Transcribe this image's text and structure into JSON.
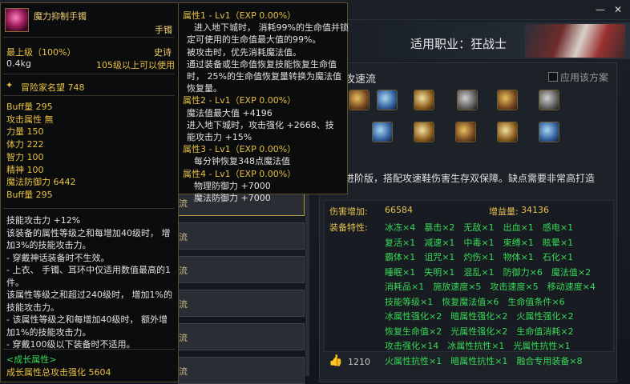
{
  "right_panel": {
    "job_label": "适用职业：狂战士",
    "plan_title": "攻速流",
    "apply_label": "应用该方案",
    "description": "进阶版，搭配攻速鞋伤害生存双保障。缺点需要非常高打造",
    "damage_label": "伤害增加:",
    "damage_value": "66584",
    "gain_label": "增益量:",
    "gain_value": "34136",
    "traits_label": "装备特性:",
    "traits": [
      "冰冻×4　暴击×2　无敌×1　出血×1　感电×1",
      "复活×1　减速×1　中毒×1　束缚×1　眩晕×1",
      "霸体×1　诅咒×1　灼伤×1　物体×1　石化×1",
      "睡眠×1　失明×1　混乱×1　防御力×6　魔法值×2",
      "消耗品×1　施放速度×5　攻击速度×5　移动速度×4",
      "技能等级×1　恢复魔法值×6　生命值条件×6",
      "冰属性强化×2　暗属性强化×2　火属性强化×2",
      "恢复生命值×2　光属性强化×2　生命值消耗×2",
      "攻击强化×14　冰属性抗性×1　光属性抗性×1",
      "火属性抗性×1　暗属性抗性×1　融合专用装备×8"
    ],
    "like_count": "1210"
  },
  "list_rows": [
    "流",
    "流",
    "流",
    "流",
    "流",
    "流"
  ],
  "item_tooltip": {
    "name": "魔力抑制手镯",
    "type": "手镯",
    "grade": "最上级（100%）",
    "rarity": "史诗",
    "weight": "0.4kg",
    "requirement": "105级以上可以使用",
    "adventurer_fame": "冒险家名望 748",
    "base_stats": [
      "Buff量 295",
      "攻击属性 無",
      "力量 150",
      "体力 222",
      "智力 100",
      "精神 100",
      "魔法防御力 6442",
      "Buff量 295"
    ],
    "skill_text": [
      "技能攻击力 +12%",
      "该装备的属性等级之和每增加40级时， 增",
      "加3%的技能攻击力。",
      "- 穿戴神话装备时不生效。",
      "- 上衣、 手镯、耳环中仅适用数值最高的1",
      "件。",
      "该属性等级之和超过240级时， 增加1%的",
      "技能攻击力。",
      "- 该属性等级之和每增加40级时， 额外增",
      "加1%的技能攻击力。",
      "- 穿戴100级以下装备时不适用。"
    ],
    "growth_title": "<成长属性>",
    "growth_text": "成长属性总攻击强化 5604"
  },
  "property_tooltip": {
    "lines": [
      {
        "k": "t",
        "text": "属性1 - Lv1（EXP 0.00%）"
      },
      {
        "k": "w",
        "text": "进入地下城时， 消耗99%的生命值并锁"
      },
      {
        "k": "w2",
        "text": "定可使用的生命值最大值的99%。"
      },
      {
        "k": "w2",
        "text": "被攻击时，优先消耗魔法值。"
      },
      {
        "k": "w2",
        "text": "通过装备或生命值恢复技能恢复生命值"
      },
      {
        "k": "w2",
        "text": "时， 25%的生命值恢复量转换为魔法值"
      },
      {
        "k": "w2",
        "text": "恢复量。"
      },
      {
        "k": "t",
        "text": "属性2 - Lv1（EXP 0.00%）"
      },
      {
        "k": "w2",
        "text": "魔法值最大值 +4196"
      },
      {
        "k": "w2",
        "text": "进入地下城时，攻击强化 +2668、技"
      },
      {
        "k": "w2",
        "text": "能攻击力 +15%"
      },
      {
        "k": "t",
        "text": "属性3 - Lv1（EXP 0.00%）"
      },
      {
        "k": "w",
        "text": "每分钟恢复348点魔法值"
      },
      {
        "k": "t",
        "text": "属性4 - Lv1（EXP 0.00%）"
      },
      {
        "k": "w",
        "text": "物理防御力 +7000"
      },
      {
        "k": "w",
        "text": "魔法防御力 +7000"
      }
    ]
  },
  "window_controls": {
    "minimize": "—",
    "close": "✕"
  }
}
